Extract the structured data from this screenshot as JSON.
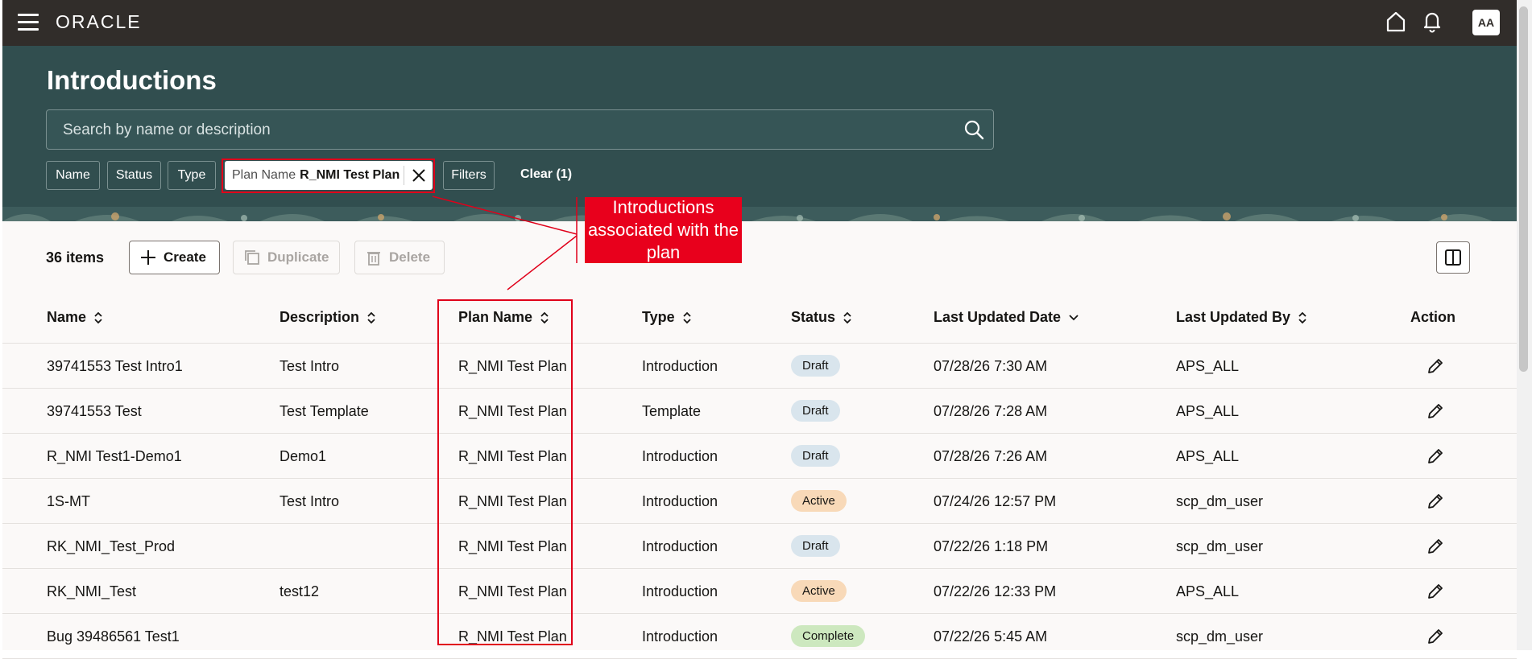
{
  "header": {
    "logo": "ORACLE",
    "avatar_initials": "AA",
    "icons": [
      "hamburger-menu-icon",
      "home-icon",
      "bell-icon"
    ]
  },
  "page": {
    "title": "Introductions",
    "search_placeholder": "Search by name or description"
  },
  "filters": {
    "chips": [
      "Name",
      "Status",
      "Type"
    ],
    "active_chip": {
      "key": "Plan Name",
      "value": "R_NMI Test Plan"
    },
    "filters_label": "Filters",
    "clear_label": "Clear (1)"
  },
  "toolbar": {
    "count": "36 items",
    "create_label": "Create",
    "duplicate_label": "Duplicate",
    "delete_label": "Delete"
  },
  "table": {
    "columns": [
      "Name",
      "Description",
      "Plan Name",
      "Type",
      "Status",
      "Last Updated Date",
      "Last Updated By",
      "Action"
    ],
    "rows": [
      {
        "name": "39741553 Test Intro1",
        "description": "Test Intro",
        "plan": "R_NMI Test Plan",
        "type": "Introduction",
        "status": "Draft",
        "date": "07/28/26 7:30 AM",
        "by": "APS_ALL"
      },
      {
        "name": "39741553 Test",
        "description": "Test Template",
        "plan": "R_NMI Test Plan",
        "type": "Template",
        "status": "Draft",
        "date": "07/28/26 7:28 AM",
        "by": "APS_ALL"
      },
      {
        "name": "R_NMI Test1-Demo1",
        "description": "Demo1",
        "plan": "R_NMI Test Plan",
        "type": "Introduction",
        "status": "Draft",
        "date": "07/28/26 7:26 AM",
        "by": "APS_ALL"
      },
      {
        "name": "1S-MT",
        "description": "Test Intro",
        "plan": "R_NMI Test Plan",
        "type": "Introduction",
        "status": "Active",
        "date": "07/24/26 12:57 PM",
        "by": "scp_dm_user"
      },
      {
        "name": "RK_NMI_Test_Prod",
        "description": "",
        "plan": "R_NMI Test Plan",
        "type": "Introduction",
        "status": "Draft",
        "date": "07/22/26 1:18 PM",
        "by": "scp_dm_user"
      },
      {
        "name": "RK_NMI_Test",
        "description": "test12",
        "plan": "R_NMI Test Plan",
        "type": "Introduction",
        "status": "Active",
        "date": "07/22/26 12:33 PM",
        "by": "APS_ALL"
      },
      {
        "name": "Bug 39486561 Test1",
        "description": "",
        "plan": "R_NMI Test Plan",
        "type": "Introduction",
        "status": "Complete",
        "date": "07/22/26 5:45 AM",
        "by": "scp_dm_user"
      }
    ]
  },
  "annotation": {
    "callout_text": "Introductions associated with the plan",
    "color": "#e8001c"
  },
  "colors": {
    "topbar": "#312d2a",
    "hero": "#314e4f",
    "draft_badge": "#d9e5ed",
    "active_badge": "#f8d9b8",
    "complete_badge": "#cde8bf"
  }
}
